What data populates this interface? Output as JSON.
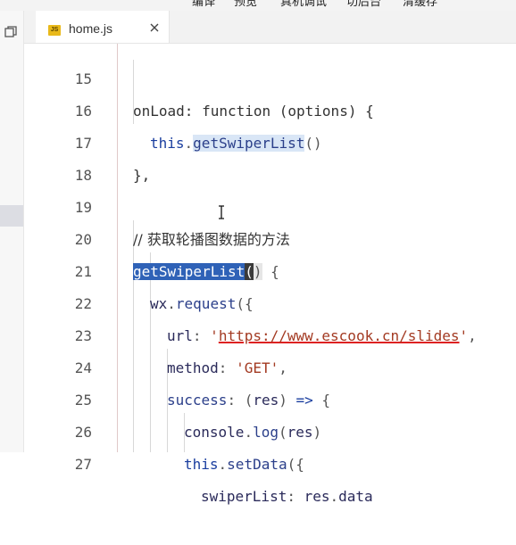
{
  "toolbar": {
    "items": [
      "编译",
      "预览",
      "真机调试",
      "切后台",
      "清缓存"
    ]
  },
  "tabs": [
    {
      "badge": "JS",
      "label": "home.js"
    }
  ],
  "icons": {
    "activity": "files-icon",
    "tab_close": "close-icon",
    "file_type": "js-file-icon"
  },
  "colors": {
    "keyword": "#1a3e9f",
    "string": "#a33a22",
    "comment": "#2f8a2f",
    "selection": "#2f62b7",
    "highlight": "#d9e6f6"
  },
  "editor": {
    "lines": [
      {
        "number": "15",
        "text": "onLoad: function (options) {"
      },
      {
        "number": "16",
        "text": "this.getSwiperList()"
      },
      {
        "number": "17",
        "text": "},"
      },
      {
        "number": "18",
        "text": ""
      },
      {
        "number": "19",
        "text": "// 获取轮播图数据的方法"
      },
      {
        "number": "20",
        "text": "getSwiperList() {"
      },
      {
        "number": "21",
        "text": "wx.request({"
      },
      {
        "number": "22",
        "text": "url: 'https://www.escook.cn/slides',"
      },
      {
        "number": "23",
        "text": "method: 'GET',"
      },
      {
        "number": "24",
        "text": "success: (res) => {"
      },
      {
        "number": "25",
        "text": "console.log(res)"
      },
      {
        "number": "26",
        "text": "this.setData({"
      },
      {
        "number": "27",
        "text": "swiperList: res.data"
      }
    ]
  }
}
